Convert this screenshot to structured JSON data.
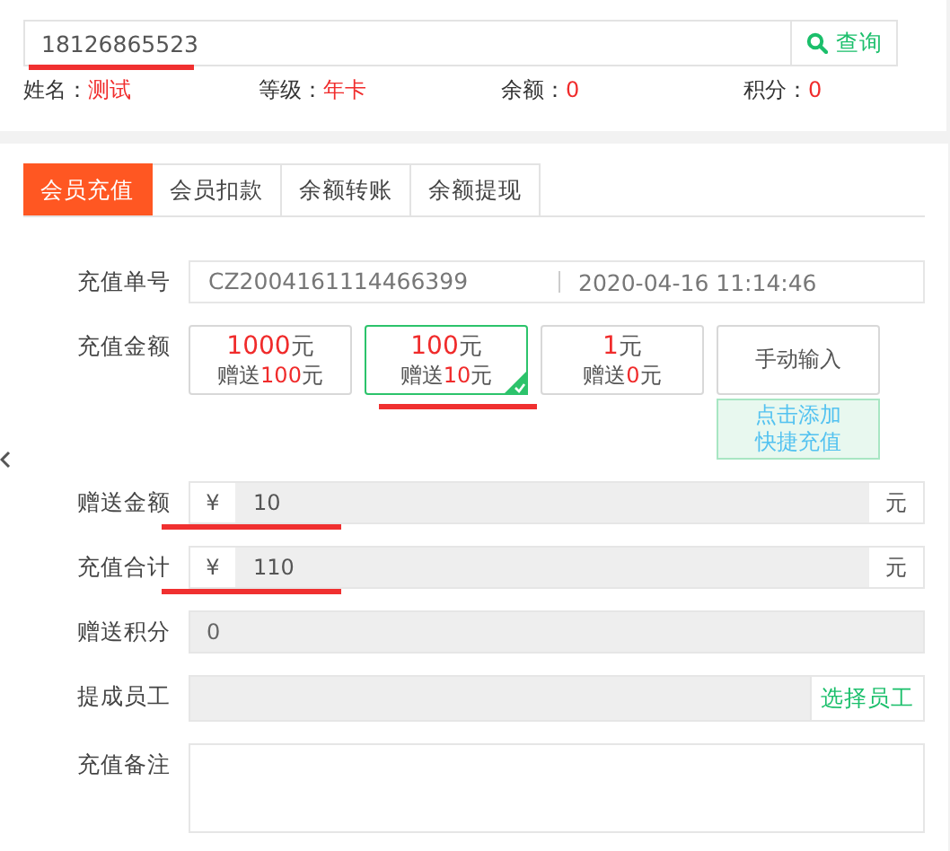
{
  "search": {
    "value": "18126865523",
    "underlined": true,
    "button": "查询"
  },
  "member_info": [
    {
      "label": "姓名：",
      "value": "测试"
    },
    {
      "label": "等级：",
      "value": "年卡"
    },
    {
      "label": "余额：",
      "value": "0"
    },
    {
      "label": "积分：",
      "value": "0"
    }
  ],
  "tabs": [
    {
      "label": "会员充值",
      "selected": true
    },
    {
      "label": "会员扣款",
      "selected": false
    },
    {
      "label": "余额转账",
      "selected": false
    },
    {
      "label": "余额提现",
      "selected": false
    }
  ],
  "order": {
    "label": "充值单号",
    "number": "CZ2004161114466399",
    "time": "2020-04-16 11:14:46"
  },
  "amount": {
    "label": "充值金额",
    "manual": "手动输入",
    "quick_add": "点击添加快捷充值",
    "options": [
      {
        "amount": "1000",
        "unit": "元",
        "bonus_prefix": "赠送",
        "bonus": "100",
        "bonus_unit": "元",
        "selected": false,
        "underlined": false
      },
      {
        "amount": "100",
        "unit": "元",
        "bonus_prefix": "赠送",
        "bonus": "10",
        "bonus_unit": "元",
        "selected": true,
        "underlined": true
      },
      {
        "amount": "1",
        "unit": "元",
        "bonus_prefix": "赠送",
        "bonus": "0",
        "bonus_unit": "元",
        "selected": false,
        "underlined": false
      }
    ]
  },
  "fields": [
    {
      "kind": "money",
      "label": "赠送金额",
      "prefix": "¥",
      "value": "10",
      "suffix": "元",
      "underlined": true
    },
    {
      "kind": "money",
      "label": "充值合计",
      "prefix": "¥",
      "value": "110",
      "suffix": "元",
      "underlined": true
    },
    {
      "kind": "readonly",
      "label": "赠送积分",
      "value": "0"
    },
    {
      "kind": "picker",
      "label": "提成员工",
      "button": "选择员工"
    },
    {
      "kind": "textarea",
      "label": "充值备注"
    }
  ]
}
